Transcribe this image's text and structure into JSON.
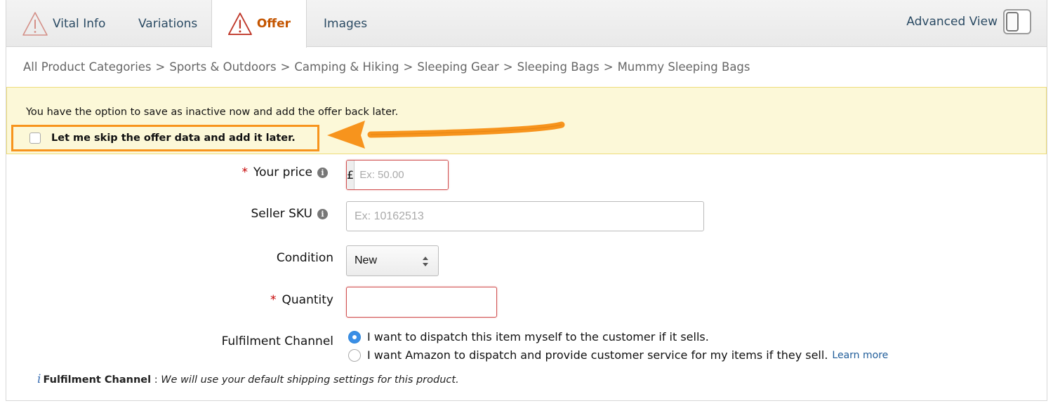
{
  "tabs": [
    {
      "label": "Vital Info",
      "icon": "warning-triangle-icon",
      "active": false
    },
    {
      "label": "Variations",
      "active": false
    },
    {
      "label": "Offer",
      "icon": "warning-triangle-icon",
      "active": true
    },
    {
      "label": "Images",
      "active": false
    }
  ],
  "advanced_view": {
    "label": "Advanced View"
  },
  "breadcrumb": [
    "All Product Categories",
    "Sports & Outdoors",
    "Camping & Hiking",
    "Sleeping Gear",
    "Sleeping Bags",
    "Mummy Sleeping Bags"
  ],
  "breadcrumb_sep": ">",
  "notice": {
    "text": "You have the option to save as inactive now and add the offer back later.",
    "skip_label": "Let me skip the offer data and add it later."
  },
  "form": {
    "price": {
      "label": "Your price",
      "currency": "£",
      "placeholder": "Ex: 50.00",
      "required": "*"
    },
    "sku": {
      "label": "Seller SKU",
      "placeholder": "Ex: 10162513"
    },
    "condition": {
      "label": "Condition",
      "value": "New"
    },
    "quantity": {
      "label": "Quantity",
      "required": "*"
    },
    "fulfilment": {
      "label": "Fulfilment Channel",
      "options": [
        {
          "text": "I want to dispatch this item myself to the customer if it sells.",
          "selected": true
        },
        {
          "text": "I want Amazon to dispatch and provide customer service for my items if they sell.",
          "selected": false,
          "link": "Learn more"
        }
      ]
    }
  },
  "footer_note": {
    "icon": "i",
    "title": "Fulfilment Channel",
    "sep": ":",
    "text": "We will use your default shipping settings for this product."
  },
  "colors": {
    "accent_orange": "#f7941d",
    "required_red": "#c40000",
    "active_tab": "#c45500",
    "notice_bg": "#fcf8d8"
  }
}
